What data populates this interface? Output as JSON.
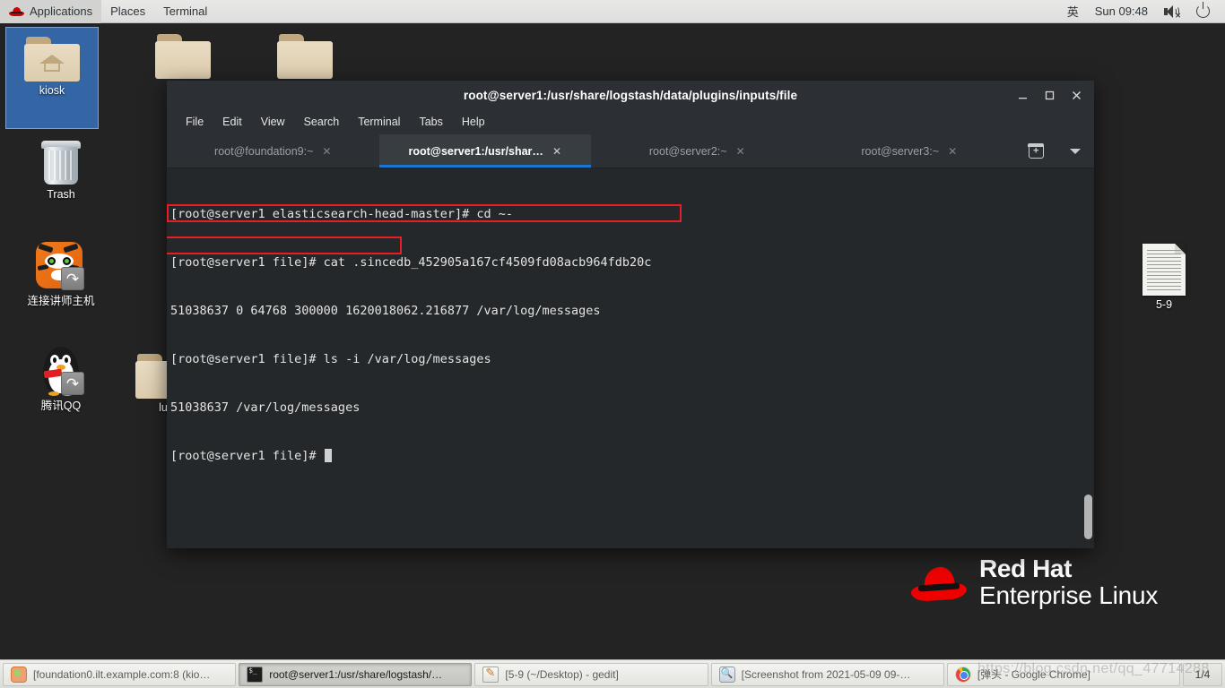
{
  "top_panel": {
    "menus": [
      "Applications",
      "Places",
      "Terminal"
    ],
    "logo_icon": "redhat-logo-icon",
    "input_method": "英",
    "clock": "Sun 09:48",
    "volume_icon": "volume-muted-icon",
    "power_icon": "power-icon"
  },
  "desktop": {
    "icons": [
      {
        "label": "kiosk",
        "icon": "home-folder-icon",
        "selected": true
      },
      {
        "label": "Trash",
        "icon": "trash-icon",
        "selected": false
      },
      {
        "label": "连接讲师主机",
        "icon": "tiger-shortcut-icon",
        "selected": false
      },
      {
        "label": "腾讯QQ",
        "icon": "qq-penguin-shortcut-icon",
        "selected": false
      },
      {
        "label": "",
        "icon": "folder-icon",
        "selected": false
      },
      {
        "label": "",
        "icon": "folder-icon",
        "selected": false
      },
      {
        "label": "lu",
        "icon": "folder-icon",
        "selected": false
      },
      {
        "label": "5-9",
        "icon": "text-document-icon",
        "selected": false
      }
    ]
  },
  "branding": {
    "line1": "Red Hat",
    "line2": "Enterprise Linux",
    "logo_icon": "redhat-hat-logo-icon"
  },
  "terminal_window": {
    "title": "root@server1:/usr/share/logstash/data/plugins/inputs/file",
    "window_buttons": {
      "minimize": "_",
      "maximize": "▢",
      "close": "✕"
    },
    "menus": [
      "File",
      "Edit",
      "View",
      "Search",
      "Terminal",
      "Tabs",
      "Help"
    ],
    "tabs": [
      {
        "label": "root@foundation9:~",
        "active": false,
        "close": "✕"
      },
      {
        "label": "root@server1:/usr/shar…",
        "active": true,
        "close": "✕"
      },
      {
        "label": "root@server2:~",
        "active": false,
        "close": "✕"
      },
      {
        "label": "root@server3:~",
        "active": false,
        "close": "✕"
      }
    ],
    "tab_tools": {
      "new_tab_icon": "new-tab-icon",
      "tab_list_icon": "chevron-down-icon"
    },
    "lines": [
      "[root@server1 elasticsearch-head-master]# cd ~-",
      "[root@server1 file]# cat .sincedb_452905a167cf4509fd08acb964fdb20c",
      "51038637 0 64768 300000 1620018062.216877 /var/log/messages",
      "[root@server1 file]# ls -i /var/log/messages",
      "51038637 /var/log/messages",
      "[root@server1 file]# "
    ],
    "highlight_color": "#ec1c24",
    "highlights": [
      {
        "line": 2,
        "note": "sincedb record highlighted"
      },
      {
        "line": 4,
        "note": "inode number highlighted"
      }
    ],
    "scrollbar": {
      "position": "bottom"
    }
  },
  "taskbar": {
    "buttons": [
      {
        "label": "[foundation0.ilt.example.com:8  (kio…",
        "icon": "kiosk-icon",
        "active": false
      },
      {
        "label": "root@server1:/usr/share/logstash/…",
        "icon": "terminal-icon",
        "active": true
      },
      {
        "label": "[5-9 (~/Desktop) - gedit]",
        "icon": "gedit-icon",
        "active": false
      },
      {
        "label": "[Screenshot from 2021-05-09 09-…",
        "icon": "image-viewer-icon",
        "active": false
      },
      {
        "label": "[弹头 - Google Chrome]",
        "icon": "chrome-icon",
        "active": false
      }
    ],
    "workspace_indicator": "1/4"
  },
  "watermark": "https://blog.csdn.net/qq_47714288"
}
